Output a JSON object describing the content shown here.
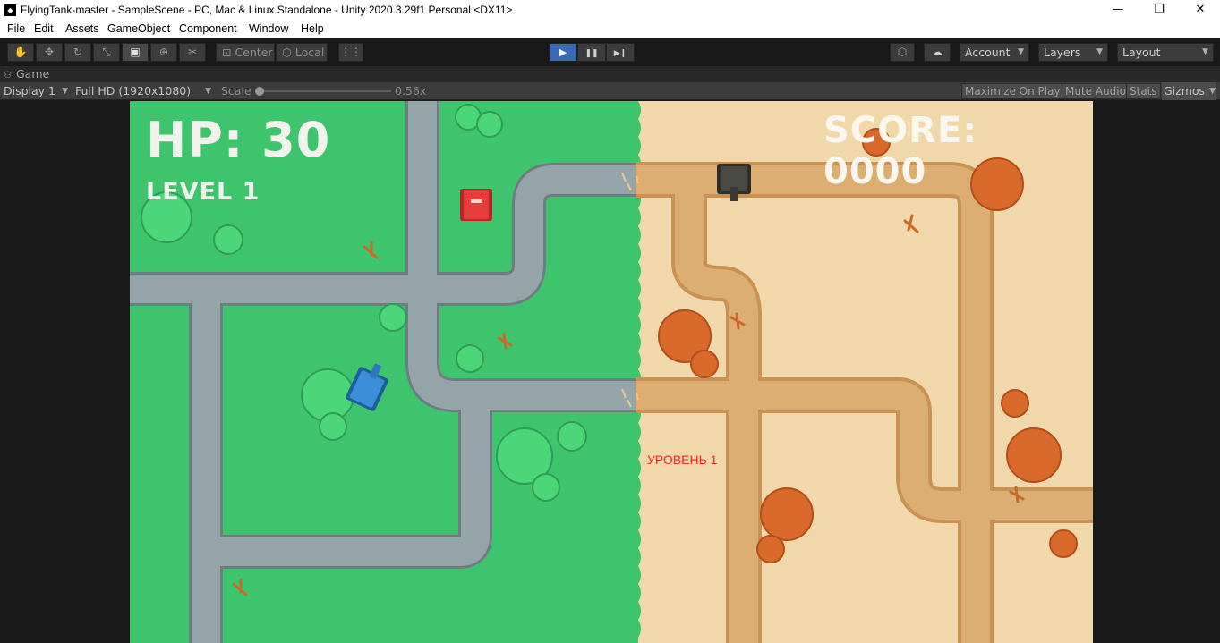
{
  "window": {
    "title": "FlyingTank-master - SampleScene - PC, Mac & Linux Standalone - Unity 2020.3.29f1 Personal <DX11>",
    "app_icon": "unity-icon",
    "minimize_glyph": "—",
    "maximize_glyph": "❐",
    "close_glyph": "✕"
  },
  "menu": [
    "File",
    "Edit",
    "Assets",
    "GameObject",
    "Component",
    "Window",
    "Help"
  ],
  "toolbar": {
    "tools": [
      {
        "icon": "hand-icon",
        "glyph": "✋"
      },
      {
        "icon": "move-icon",
        "glyph": "✥"
      },
      {
        "icon": "rotate-icon",
        "glyph": "↻"
      },
      {
        "icon": "scale-icon",
        "glyph": "⤡"
      },
      {
        "icon": "rect-icon",
        "glyph": "▣"
      },
      {
        "icon": "transform-icon",
        "glyph": "⊕"
      },
      {
        "icon": "custom-tool-icon",
        "glyph": "✂"
      }
    ],
    "active_tool": "rect-icon",
    "pivot": "Center",
    "space": "Local",
    "snap_glyph": "⋮⋮",
    "play_glyph": "▶",
    "pause_glyph": "❚❚",
    "step_glyph": "▶❙",
    "playing": true,
    "account": "Account",
    "layers": "Layers",
    "layout": "Layout",
    "collab_glyph": "⬡",
    "cloud_glyph": "☁"
  },
  "game_tab": {
    "label": "Game",
    "icon_glyph": "⚇"
  },
  "game_bar": {
    "display": "Display 1",
    "resolution": "Full HD (1920x1080)",
    "scale_label": "Scale",
    "scale_value": "0.56x",
    "scale_fraction": 0.0,
    "maximize_on_play": "Maximize On Play",
    "mute_audio": "Mute Audio",
    "stats": "Stats",
    "gizmos": "Gizmos"
  },
  "hud": {
    "hp": "HP: 30",
    "level": "LEVEL 1",
    "score": "SCORE: 0000",
    "level_caption": "УРОВЕНЬ 1"
  },
  "colors": {
    "grass": "#3ec46d",
    "sand": "#f1d8ab",
    "road_gray": "#8c9aa0",
    "road_sand": "#d9a96b",
    "bush_green": "#4bd67a",
    "bush_orange": "#d96a2b",
    "player_tank": "#3d8ed8",
    "enemy_tank_red": "#e83b3b",
    "enemy_tank_dark": "#4a4a44",
    "play_active": "#3c6ab1",
    "caption_red": "#ff1f1f"
  }
}
